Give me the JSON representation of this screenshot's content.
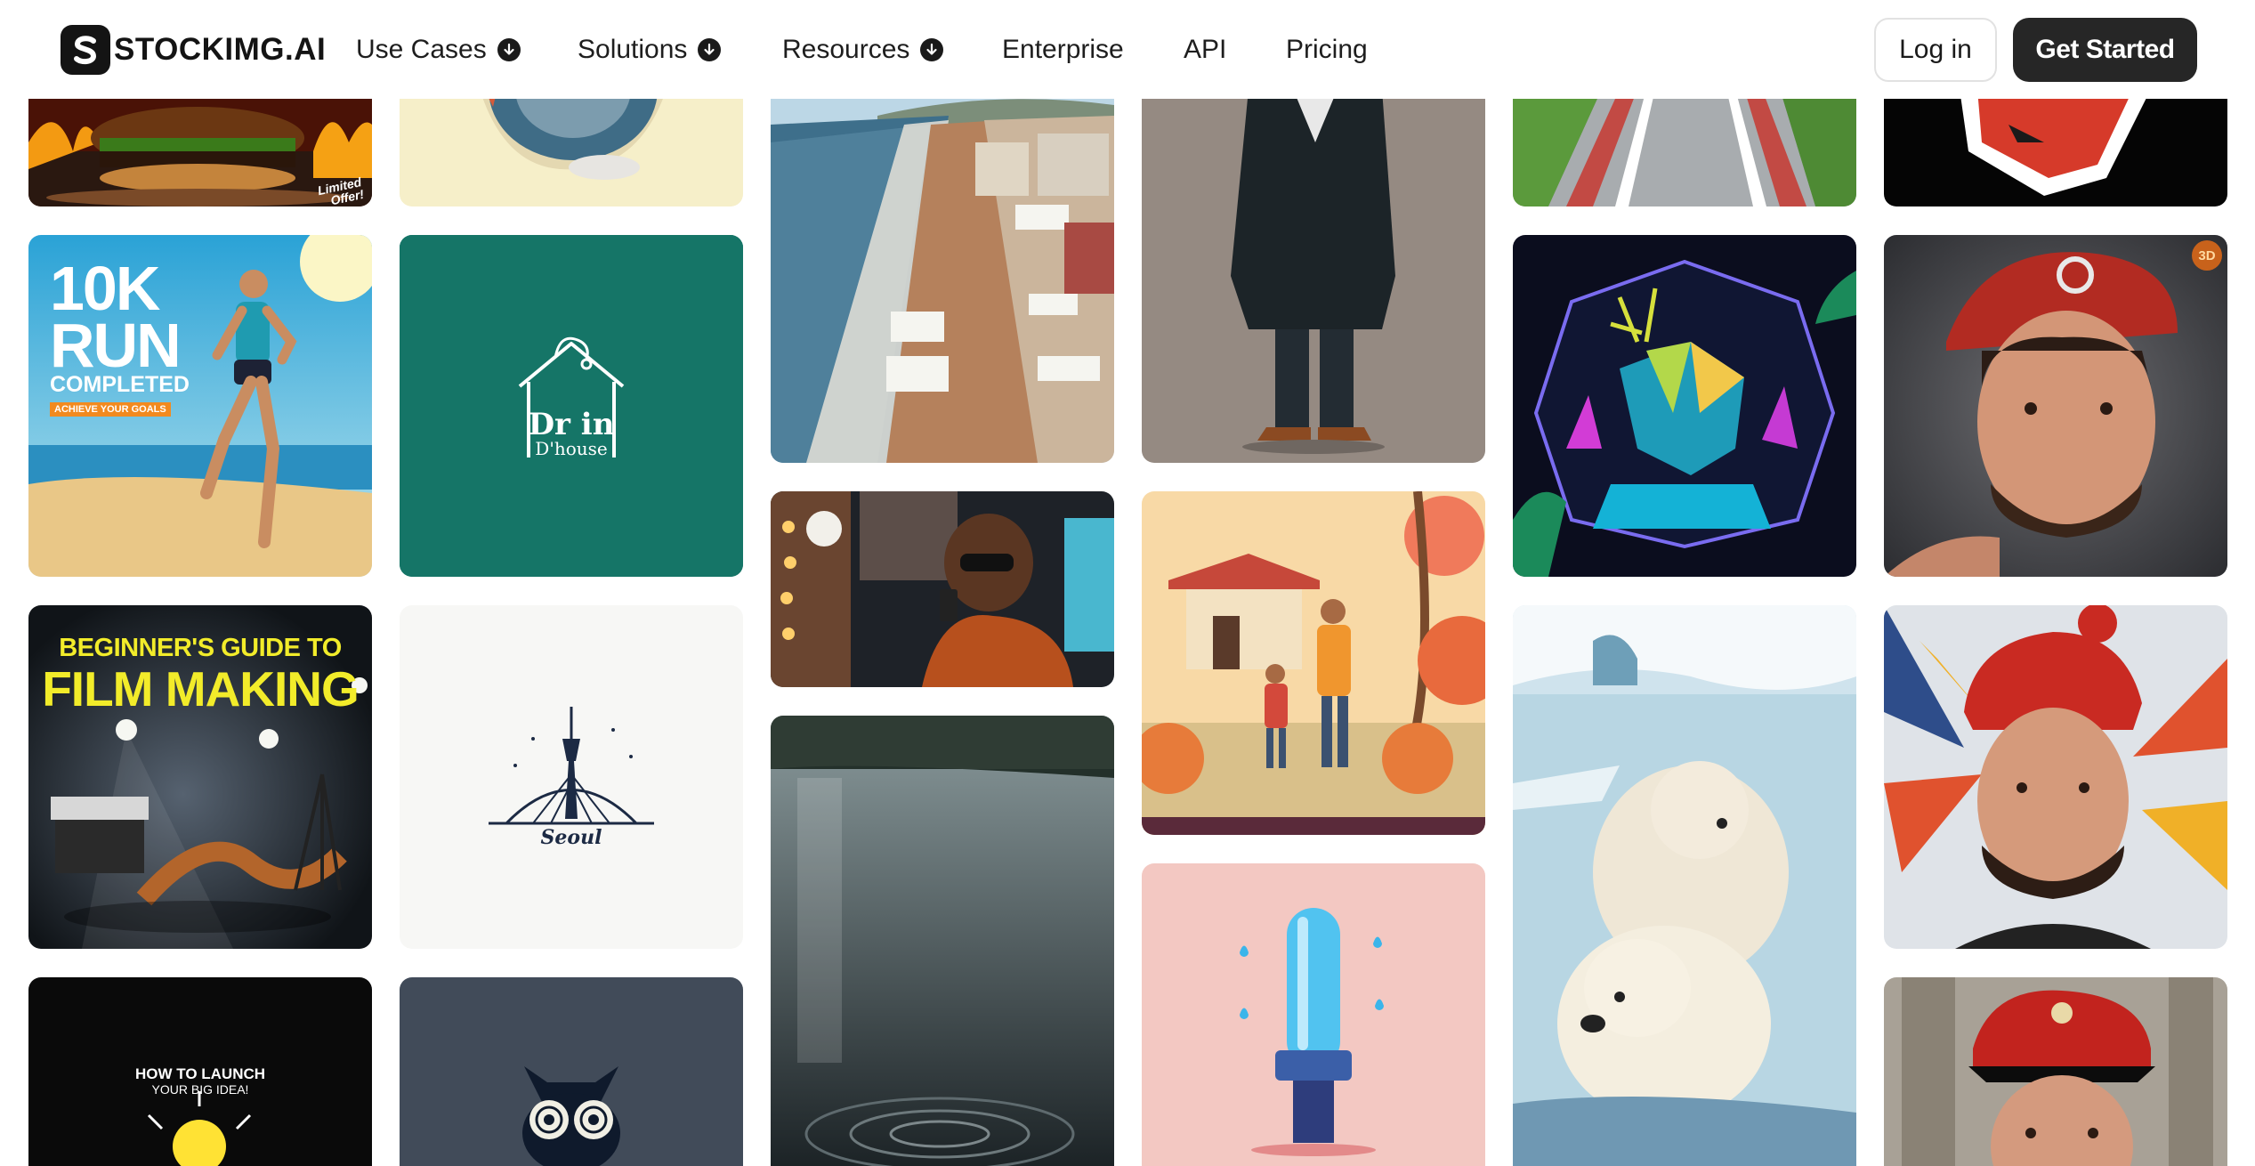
{
  "brand": {
    "name": "STOCKIMG.AI"
  },
  "nav": {
    "items": [
      {
        "label": "Use Cases",
        "dropdown": true
      },
      {
        "label": "Solutions",
        "dropdown": true
      },
      {
        "label": "Resources",
        "dropdown": true
      },
      {
        "label": "Enterprise",
        "dropdown": false
      },
      {
        "label": "API",
        "dropdown": false
      },
      {
        "label": "Pricing",
        "dropdown": false
      }
    ],
    "login_label": "Log in",
    "cta_label": "Get Started"
  },
  "gallery": {
    "burger": {
      "badge_line1": "Limited",
      "badge_line2": "Offer!"
    },
    "run": {
      "line1": "10K",
      "line2": "RUN",
      "line3": "COMPLETED",
      "line4": "ACHIEVE YOUR GOALS"
    },
    "logo_dr": {
      "line1": "Dr in",
      "line2": "D'house"
    },
    "film": {
      "line1": "BEGINNER'S GUIDE TO",
      "line2": "FILM MAKING"
    },
    "seoul": {
      "label": "Seoul"
    },
    "launch": {
      "line1": "HOW TO LAUNCH",
      "line2": "YOUR BIG IDEA!"
    },
    "portrait_badge": "3D"
  },
  "colors": {
    "nav_text": "#1e1e1e",
    "cta_bg": "#262626",
    "teal_tile": "#157567",
    "owl_tile": "#414b59",
    "film_text": "#f2ec2a"
  },
  "icons": [
    "logo-s-icon",
    "chevron-down-icon"
  ]
}
